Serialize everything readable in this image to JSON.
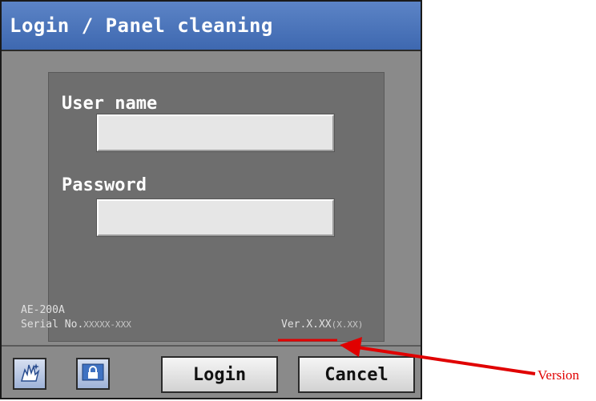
{
  "title": "Login / Panel cleaning",
  "form": {
    "username_label": "User name",
    "username_value": "",
    "password_label": "Password",
    "password_value": ""
  },
  "device": {
    "model": "AE-200A",
    "serial_prefix": "Serial No.",
    "serial_value": "XXXXX-XXX",
    "version_prefix": "Ver.",
    "version_value": "X.XX",
    "version_sub": "(X.XX)"
  },
  "buttons": {
    "panel_cleaning_icon": "cleaning-hand-icon",
    "lock_icon": "lock-icon",
    "login": "Login",
    "cancel": "Cancel"
  },
  "annotation": {
    "label": "Version",
    "color": "#e00000"
  }
}
